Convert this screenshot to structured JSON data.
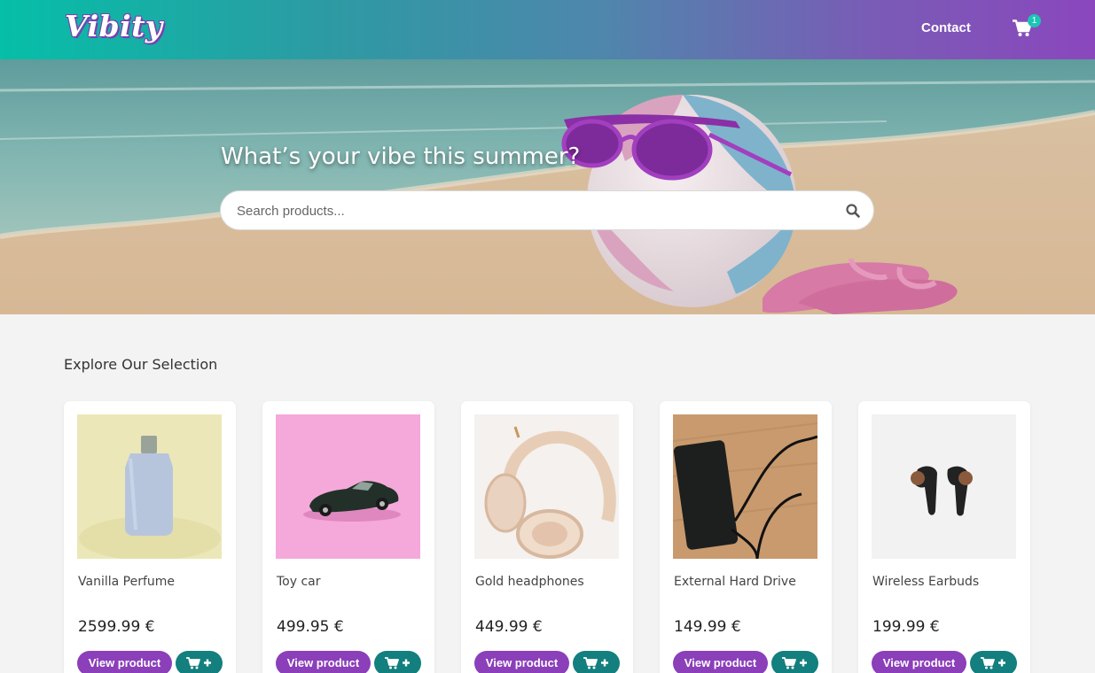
{
  "header": {
    "logo": "Vibity",
    "nav": {
      "contact_label": "Contact"
    },
    "cart": {
      "count": "1",
      "icon": "cart-icon"
    }
  },
  "hero": {
    "title": "What’s your vibe this summer?",
    "search": {
      "placeholder": "Search products...",
      "value": "",
      "icon": "search-icon"
    }
  },
  "section": {
    "title": "Explore Our Selection",
    "products": [
      {
        "name": "Vanilla Perfume",
        "price": "2599.99 €",
        "view_label": "View product",
        "add_icon": "add-to-cart-icon"
      },
      {
        "name": "Toy car",
        "price": "499.95 €",
        "view_label": "View product",
        "add_icon": "add-to-cart-icon"
      },
      {
        "name": "Gold headphones",
        "price": "449.99 €",
        "view_label": "View product",
        "add_icon": "add-to-cart-icon"
      },
      {
        "name": "External Hard Drive",
        "price": "149.99 €",
        "view_label": "View product",
        "add_icon": "add-to-cart-icon"
      },
      {
        "name": "Wireless Earbuds",
        "price": "199.99 €",
        "view_label": "View product",
        "add_icon": "add-to-cart-icon"
      }
    ]
  },
  "colors": {
    "header_gradient_start": "#05bfa8",
    "header_gradient_end": "#8a47bd",
    "view_button": "#8b3fb9",
    "cart_button": "#137f7e",
    "page_background": "#f3f3f3"
  }
}
